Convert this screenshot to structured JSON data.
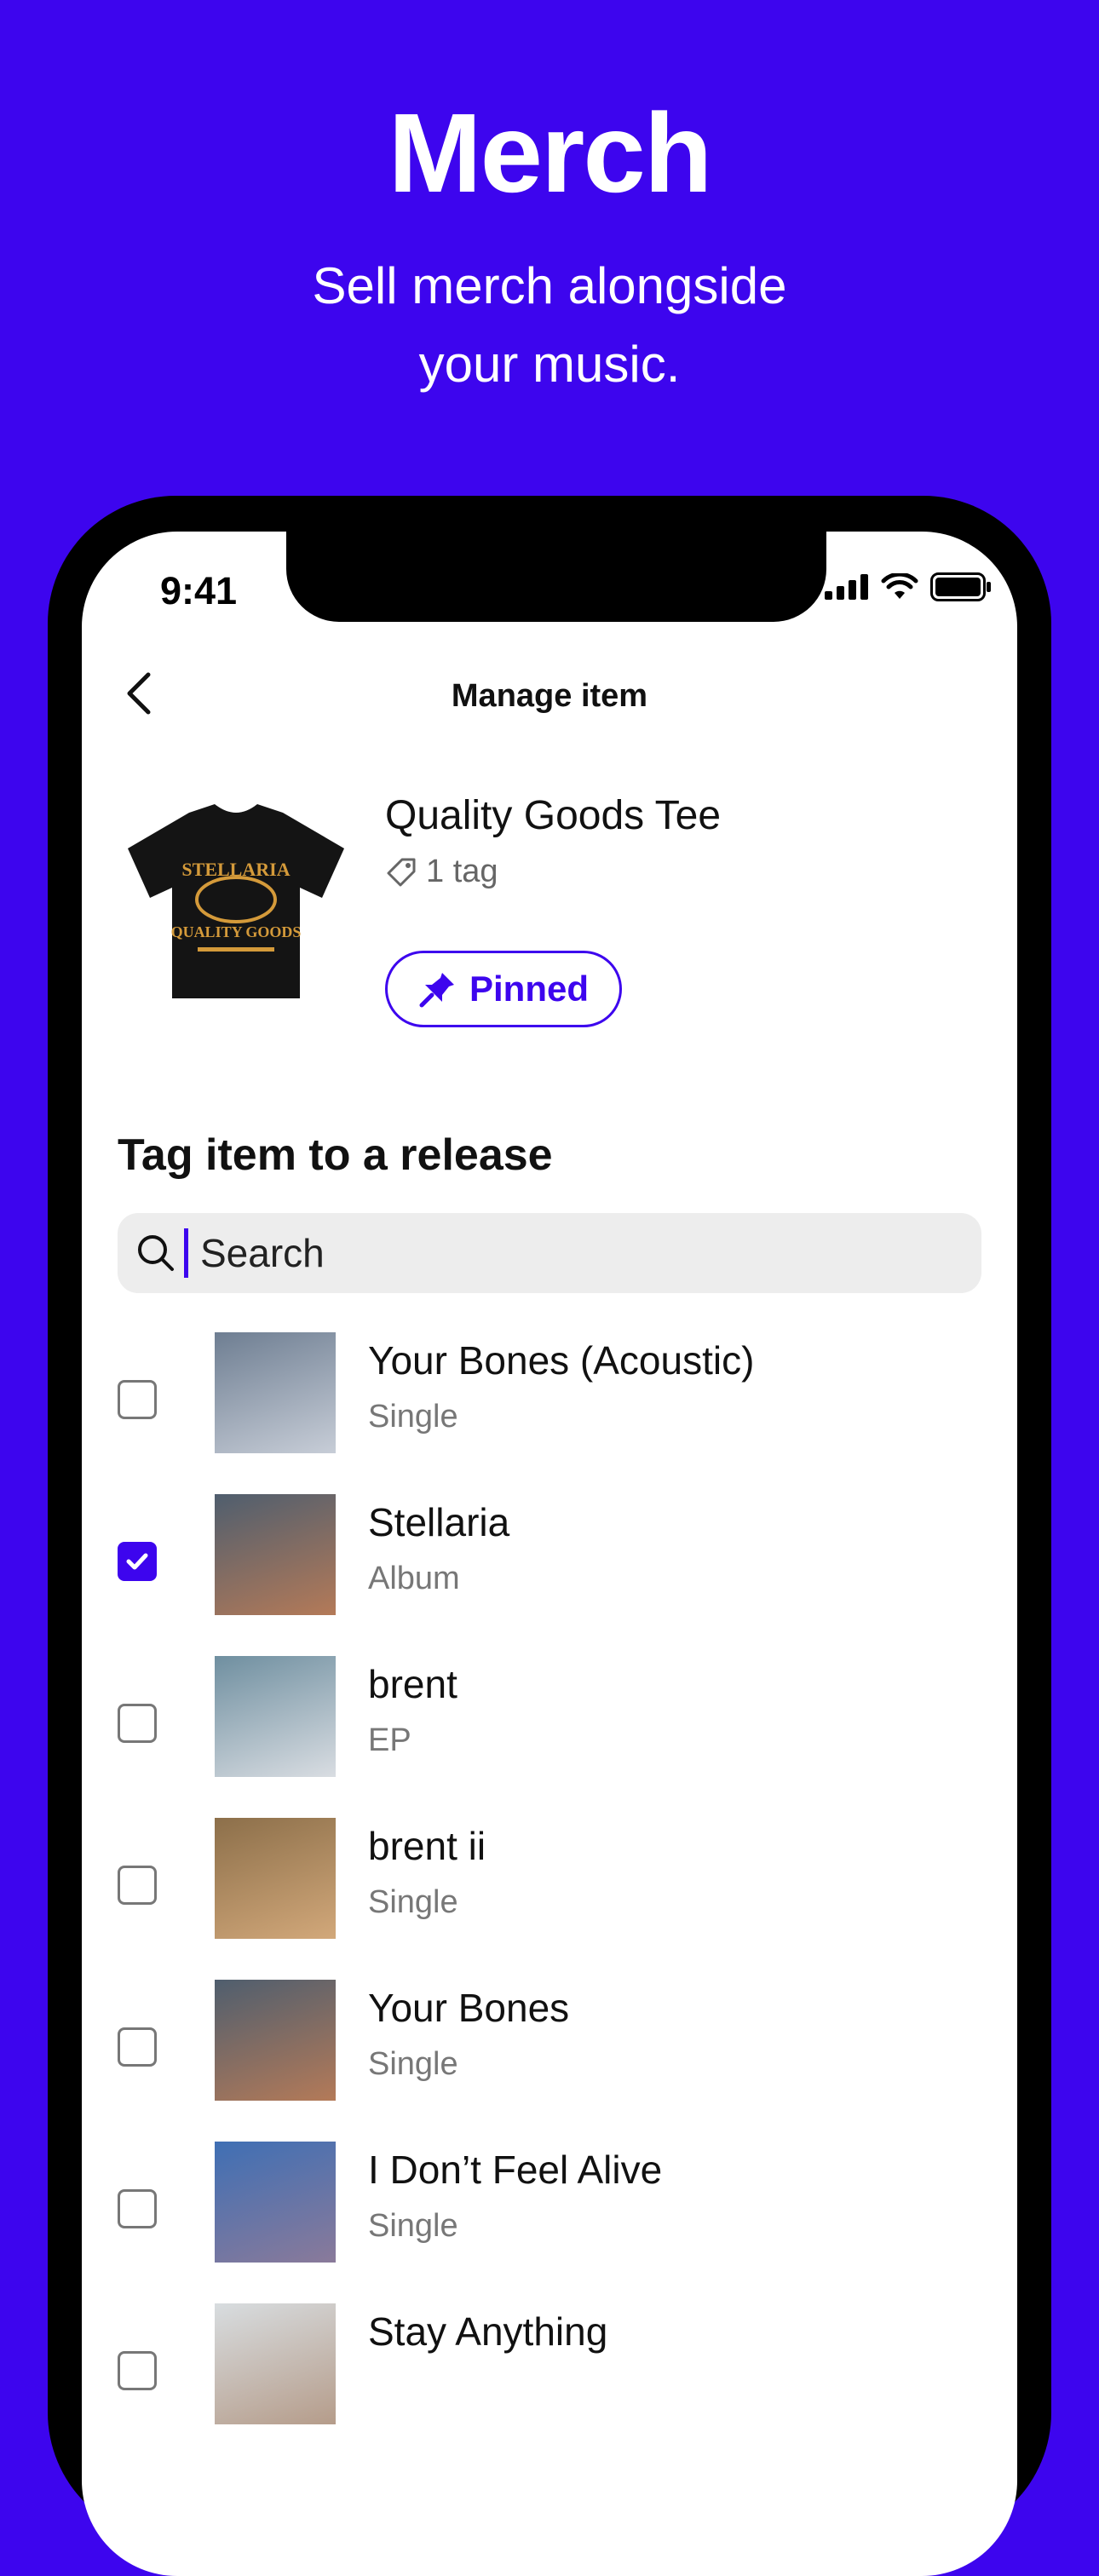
{
  "promo": {
    "title": "Merch",
    "subtitle_line1": "Sell merch alongside",
    "subtitle_line2": "your music."
  },
  "status_bar": {
    "time": "9:41"
  },
  "header": {
    "title": "Manage item"
  },
  "item": {
    "name": "Quality Goods Tee",
    "tag_count": "1 tag",
    "shirt_text": [
      "STELLARIA",
      "QUALITY GOODS"
    ],
    "pinned_label": "Pinned"
  },
  "tag_section": {
    "title": "Tag item to a release",
    "search_placeholder": "Search"
  },
  "releases": [
    {
      "title": "Your Bones (Acoustic)",
      "type": "Single",
      "checked": false,
      "cover_colors": [
        "#6E7E92",
        "#C7CDD7"
      ]
    },
    {
      "title": "Stellaria",
      "type": "Album",
      "checked": true,
      "cover_colors": [
        "#4F5E6E",
        "#B47A58"
      ]
    },
    {
      "title": "brent",
      "type": "EP",
      "checked": false,
      "cover_colors": [
        "#6F8FA0",
        "#D9DDE2"
      ]
    },
    {
      "title": "brent ii",
      "type": "Single",
      "checked": false,
      "cover_colors": [
        "#8C6F4A",
        "#D2A87A"
      ]
    },
    {
      "title": "Your Bones",
      "type": "Single",
      "checked": false,
      "cover_colors": [
        "#4F5E6E",
        "#B47A58"
      ]
    },
    {
      "title": "I Don’t Feel Alive",
      "type": "Single",
      "checked": false,
      "cover_colors": [
        "#3F6FB4",
        "#8A7A9A"
      ]
    },
    {
      "title": "Stay Anything",
      "type": "",
      "checked": false,
      "cover_colors": [
        "#D8DDE0",
        "#B59C8A"
      ]
    }
  ],
  "colors": {
    "accent": "#3D05EE",
    "background": "#3D05EE"
  }
}
